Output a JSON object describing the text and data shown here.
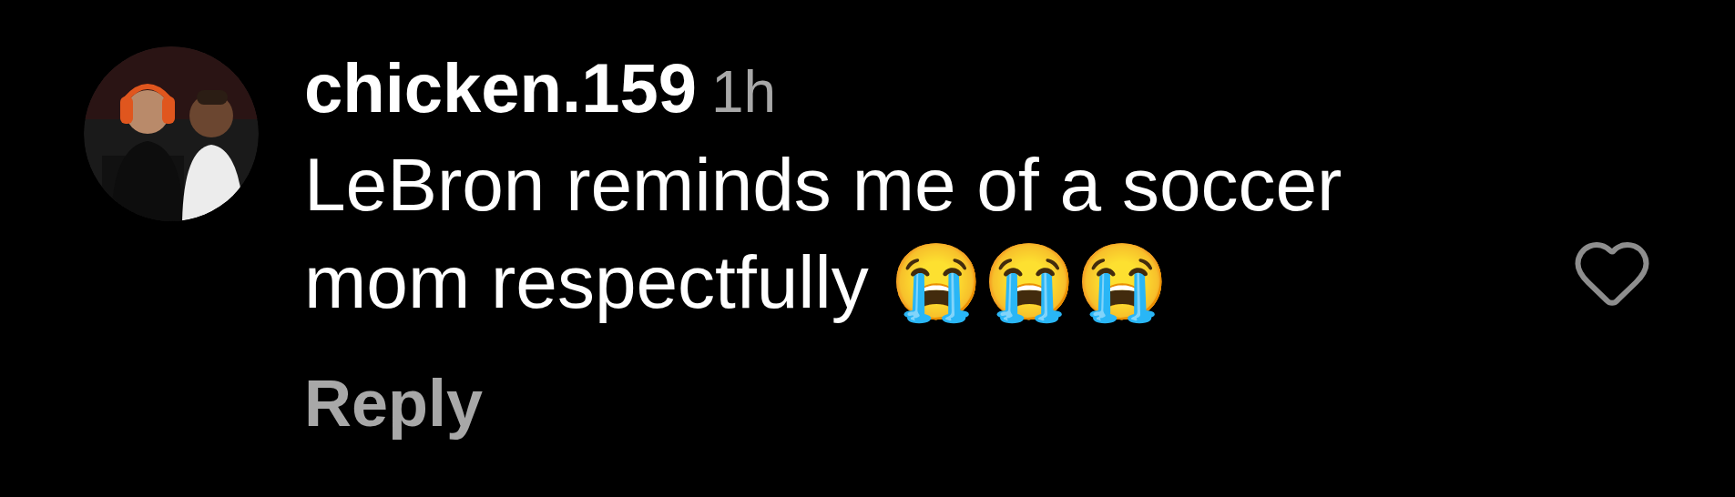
{
  "comment": {
    "username": "chicken.159",
    "time": "1h",
    "text": "LeBron reminds me of a soccer mom respectfully 😭😭😭",
    "reply": "Reply",
    "liked": false
  }
}
